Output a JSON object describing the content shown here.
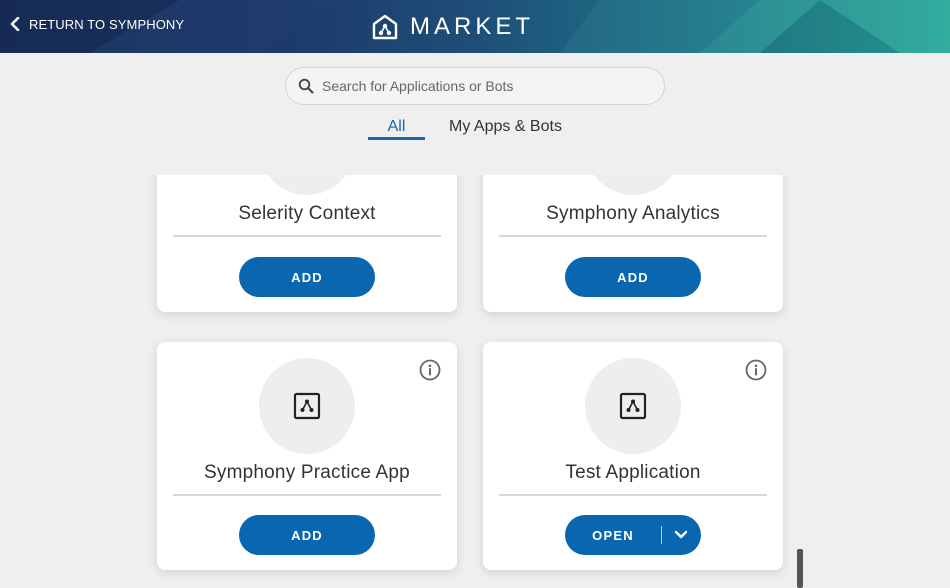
{
  "header": {
    "back_label": "RETURN TO SYMPHONY",
    "title": "MARKET",
    "back_icon": "chevron-left-icon",
    "logo_icon": "symphony-logo-icon"
  },
  "search": {
    "placeholder": "Search for Applications or Bots",
    "value": "",
    "icon": "search-icon"
  },
  "tabs": [
    {
      "label": "All",
      "active": true
    },
    {
      "label": "My Apps & Bots",
      "active": false
    }
  ],
  "apps": [
    {
      "name": "Selerity Context",
      "action": "ADD"
    },
    {
      "name": "Symphony Analytics",
      "action": "ADD"
    },
    {
      "name": "Symphony Practice App",
      "action": "ADD"
    },
    {
      "name": "Test Application",
      "action": "OPEN"
    }
  ],
  "colors": {
    "accent": "#0a67af",
    "tab_active": "#1a67ad",
    "background": "#efefef"
  }
}
